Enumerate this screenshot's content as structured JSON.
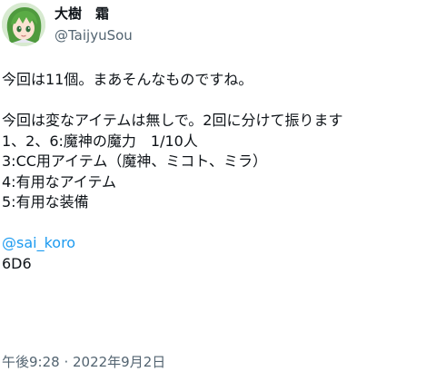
{
  "author": {
    "display_name": "大樹　霜",
    "handle": "@TaijyuSou",
    "avatar_icon": "anime-character-avatar"
  },
  "tweet": {
    "lines": [
      "今回は11個。まあそんなものですね。",
      "",
      "今回は変なアイテムは無しで。2回に分けて振ります",
      "1、2、6:魔神の魔力　1/10人",
      "3:CC用アイテム（魔神、ミコト、ミラ）",
      "4:有用なアイテム",
      "5:有用な装備",
      ""
    ],
    "mention": "@sai_koro",
    "dice": "6D6"
  },
  "meta": {
    "time": "午後9:28",
    "separator": " · ",
    "date": "2022年9月2日"
  },
  "colors": {
    "text": "#0f1419",
    "secondary": "#536471",
    "link": "#1d9bf0"
  }
}
